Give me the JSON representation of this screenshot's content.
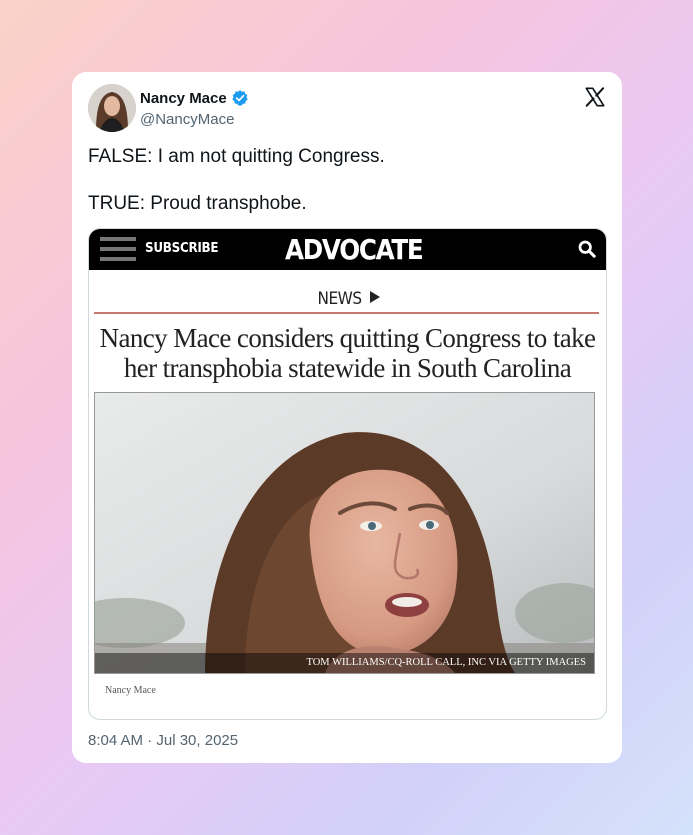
{
  "tweet": {
    "author_name": "Nancy Mace",
    "handle": "@NancyMace",
    "text_lines": [
      "FALSE: I am not quitting Congress.",
      "TRUE: Proud transphobe."
    ],
    "timestamp": "8:04 AM · Jul 30, 2025",
    "verified": true,
    "icons": {
      "platform": "x-logo-icon",
      "verified": "verified-badge-icon"
    }
  },
  "embed": {
    "header": {
      "subscribe_label": "SUBSCRIBE",
      "brand": "ADVOCATE"
    },
    "section": "NEWS",
    "headline_lines": [
      "Nancy Mace considers quitting Congress to take",
      "her transphobia statewide in South Carolina"
    ],
    "photo_credit": "TOM WILLIAMS/CQ-ROLL CALL, INC VIA GETTY IMAGES",
    "caption": "Nancy Mace"
  },
  "colors": {
    "verified_blue": "#1d9bf0",
    "header_black": "#000000",
    "rule_red": "#c97a70",
    "text_dark": "#0f1419",
    "text_muted": "#536471"
  }
}
